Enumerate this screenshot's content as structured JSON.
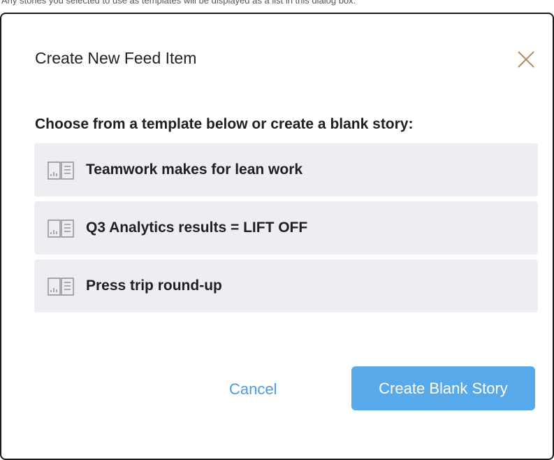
{
  "caption": "Any stories you selected to use as templates will be displayed as a list in this dialog box.",
  "dialog": {
    "title": "Create New Feed Item",
    "close_icon": "close-icon",
    "subtitle": "Choose from a template below or create a blank story:",
    "templates": [
      {
        "label": "Teamwork makes for lean work",
        "icon": "book-icon"
      },
      {
        "label": "Q3 Analytics results = LIFT OFF",
        "icon": "book-icon"
      },
      {
        "label": "Press trip round-up",
        "icon": "book-icon"
      }
    ],
    "cancel_label": "Cancel",
    "create_label": "Create Blank Story"
  },
  "colors": {
    "accent": "#58a9ea",
    "link": "#4a9be6",
    "item_background": "#edeef2",
    "close_icon": "#b08a63"
  }
}
